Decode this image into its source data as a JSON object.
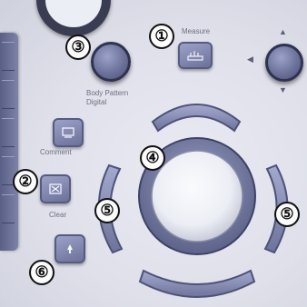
{
  "labels": {
    "measure": "Measure",
    "body_pattern": "Body Pattern",
    "digital": "Digital",
    "comment": "Comment",
    "clear": "Clear"
  },
  "callouts": {
    "c1": "①",
    "c2": "②",
    "c3": "③",
    "c4": "④",
    "c5_left": "⑤",
    "c5_right": "⑤",
    "c6": "⑥"
  },
  "icons": {
    "measure": "ruler-icon",
    "comment": "comment-icon",
    "clear": "clear-icon",
    "btn6": "arrow-icon",
    "dpad": "direction-arrows-icon"
  },
  "colors": {
    "panel": "#dfe0ea",
    "button": "#6d729b",
    "callout_ring": "#111111"
  }
}
